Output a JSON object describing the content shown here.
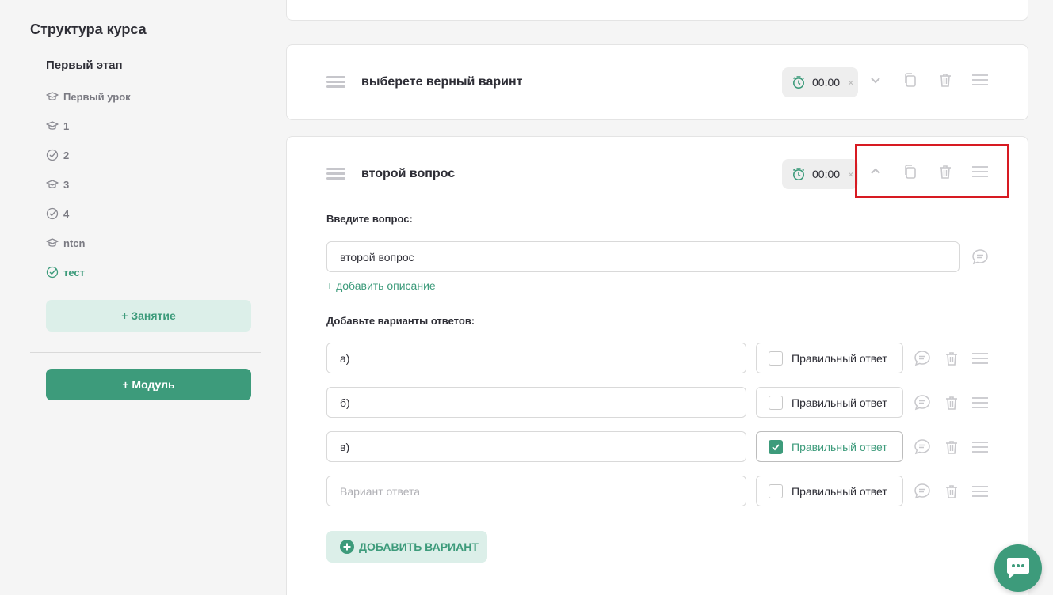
{
  "sidebar": {
    "title": "Структура курса",
    "stage": "Первый этап",
    "items": [
      {
        "label": "Первый урок",
        "icon": "graduation-cap-icon"
      },
      {
        "label": "1",
        "icon": "graduation-cap-icon"
      },
      {
        "label": "2",
        "icon": "check-circle-icon"
      },
      {
        "label": "3",
        "icon": "graduation-cap-icon"
      },
      {
        "label": "4",
        "icon": "check-circle-icon"
      },
      {
        "label": "ntcn",
        "icon": "graduation-cap-icon"
      },
      {
        "label": "тест",
        "icon": "check-circle-icon",
        "active": true
      }
    ],
    "add_lesson": "+ Занятие",
    "add_module": "+ Модуль"
  },
  "question1": {
    "title": "выберете верный варинт",
    "timer": "00:00",
    "timer_clear": "×"
  },
  "question2": {
    "title": "второй вопрос",
    "timer": "00:00",
    "timer_clear": "×",
    "question_label": "Введите вопрос:",
    "question_value": "второй вопрос",
    "add_description": "+ добавить описание",
    "answers_label": "Добавьте варианты ответов:",
    "answers": [
      {
        "value": "а)",
        "placeholder": "",
        "correct": false
      },
      {
        "value": "б)",
        "placeholder": "",
        "correct": false
      },
      {
        "value": "в)",
        "placeholder": "",
        "correct": true
      },
      {
        "value": "",
        "placeholder": "Вариант ответа",
        "correct": false
      }
    ],
    "correct_label": "Правильный ответ",
    "add_variant": "ДОБАВИТЬ ВАРИАНТ"
  },
  "colors": {
    "accent": "#3d9b7b",
    "accent_light": "#dcefe9",
    "highlight": "#d71a22"
  }
}
